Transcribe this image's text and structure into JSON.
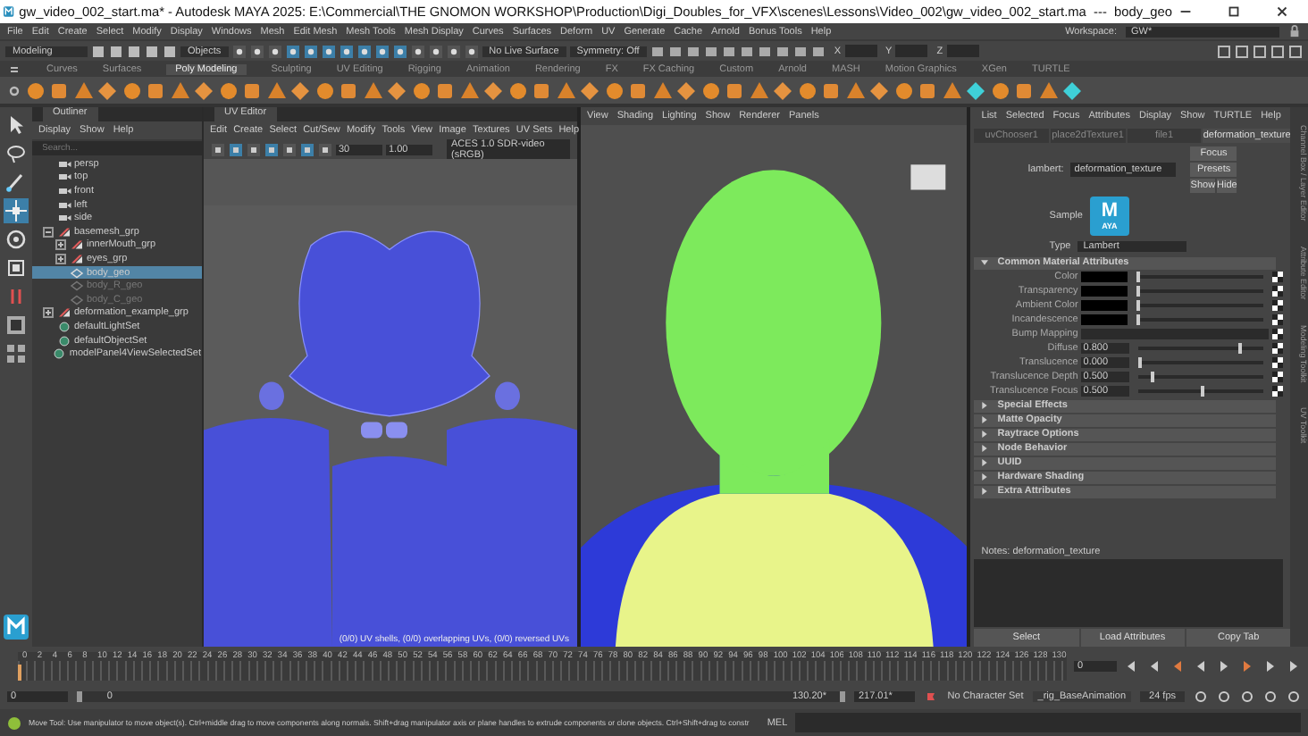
{
  "window": {
    "title": "gw_video_002_start.ma* - Autodesk MAYA 2025: E:\\Commercial\\THE GNOMON WORKSHOP\\Production\\Digi_Doubles_for_VFX\\scenes\\Lessons\\Video_002\\gw_video_002_start.ma  ---  body_geo"
  },
  "menu_bar": [
    "File",
    "Edit",
    "Create",
    "Select",
    "Modify",
    "Display",
    "Windows",
    "Mesh",
    "Edit Mesh",
    "Mesh Tools",
    "Mesh Display",
    "Curves",
    "Surfaces",
    "Deform",
    "UV",
    "Generate",
    "Cache",
    "Arnold",
    "Bonus Tools",
    "Help"
  ],
  "workspace": {
    "label": "Workspace:",
    "value": "GW*"
  },
  "status_line": {
    "menu_set": "Modeling",
    "selection_mode": "Objects",
    "live_surface": "No Live Surface",
    "symmetry": "Symmetry: Off",
    "axes": [
      "X",
      "Y",
      "Z"
    ]
  },
  "shelf_tabs": [
    {
      "label": "Curves",
      "selected": false
    },
    {
      "label": "Surfaces",
      "selected": false
    },
    {
      "label": "Poly Modeling",
      "selected": true
    },
    {
      "label": "Sculpting",
      "selected": false
    },
    {
      "label": "UV Editing",
      "selected": false
    },
    {
      "label": "Rigging",
      "selected": false
    },
    {
      "label": "Animation",
      "selected": false
    },
    {
      "label": "Rendering",
      "selected": false
    },
    {
      "label": "FX",
      "selected": false
    },
    {
      "label": "FX Caching",
      "selected": false
    },
    {
      "label": "Custom",
      "selected": false
    },
    {
      "label": "Arnold",
      "selected": false
    },
    {
      "label": "MASH",
      "selected": false
    },
    {
      "label": "Motion Graphics",
      "selected": false
    },
    {
      "label": "XGen",
      "selected": false
    },
    {
      "label": "TURTLE",
      "selected": false
    }
  ],
  "toolbox": [
    {
      "kind": "select",
      "selected": false
    },
    {
      "kind": "lasso",
      "selected": false
    },
    {
      "kind": "paint",
      "selected": false
    },
    {
      "kind": "move",
      "selected": true
    },
    {
      "kind": "rotate",
      "selected": false
    },
    {
      "kind": "scale",
      "selected": false
    }
  ],
  "outliner": {
    "title": "Outliner",
    "menu": [
      "Display",
      "Show",
      "Help"
    ],
    "search": {
      "placeholder": "Search..."
    },
    "items": [
      {
        "name": "persp",
        "kind": "camera",
        "selected": false,
        "hidden": false
      },
      {
        "name": "top",
        "kind": "camera",
        "selected": false,
        "hidden": false
      },
      {
        "name": "front",
        "kind": "camera",
        "selected": false,
        "hidden": false
      },
      {
        "name": "left",
        "kind": "camera",
        "selected": false,
        "hidden": false
      },
      {
        "name": "side",
        "kind": "camera",
        "selected": false,
        "hidden": false
      },
      {
        "name": "basemesh_grp",
        "kind": "group",
        "selected": false,
        "hidden": false,
        "expanded": true,
        "children": [
          {
            "name": "innerMouth_grp",
            "kind": "group",
            "selected": false,
            "hidden": false,
            "expanded": false
          },
          {
            "name": "eyes_grp",
            "kind": "group",
            "selected": false,
            "hidden": false,
            "expanded": false
          },
          {
            "name": "body_geo",
            "kind": "mesh",
            "selected": true,
            "hidden": false
          },
          {
            "name": "body_R_geo",
            "kind": "mesh",
            "selected": false,
            "hidden": true
          },
          {
            "name": "body_C_geo",
            "kind": "mesh",
            "selected": false,
            "hidden": true
          }
        ]
      },
      {
        "name": "deformation_example_grp",
        "kind": "group",
        "selected": false,
        "hidden": false,
        "expanded": false
      },
      {
        "name": "defaultLightSet",
        "kind": "set",
        "selected": false,
        "hidden": false
      },
      {
        "name": "defaultObjectSet",
        "kind": "set",
        "selected": false,
        "hidden": false
      },
      {
        "name": "modelPanel4ViewSelectedSet",
        "kind": "set",
        "selected": false,
        "hidden": false
      }
    ]
  },
  "uv_editor": {
    "title": "UV Editor",
    "menu": [
      "Edit",
      "Create",
      "Select",
      "Cut/Sew",
      "Modify",
      "Tools",
      "View",
      "Image",
      "Textures",
      "UV Sets",
      "Help"
    ],
    "field_1": "30",
    "field_2": "1.00",
    "color_space": "ACES 1.0 SDR-video (sRGB)",
    "info": "(0/0) UV shells, (0/0) overlapping UVs, (0/0) reversed UVs"
  },
  "viewport": {
    "menu": [
      "View",
      "Shading",
      "Lighting",
      "Show",
      "Renderer",
      "Panels"
    ]
  },
  "attribute_editor": {
    "menu": [
      "List",
      "Selected",
      "Focus",
      "Attributes",
      "Display",
      "Show",
      "TURTLE",
      "Help"
    ],
    "tabs": [
      {
        "label": "uvChooser1",
        "selected": false
      },
      {
        "label": "place2dTexture1",
        "selected": false
      },
      {
        "label": "file1",
        "selected": false
      },
      {
        "label": "deformation_texture",
        "selected": true
      }
    ],
    "node_label": "lambert:",
    "node_name": "deformation_texture",
    "buttons": [
      "Focus",
      "Presets",
      "Show",
      "Hide"
    ],
    "sample_label": "Sample",
    "logo_letter": "M",
    "logo_word": "AYA",
    "type_label": "Type",
    "type_value": "Lambert",
    "sections": [
      {
        "title": "Common Material Attributes",
        "expanded": true,
        "rows": [
          {
            "kind": "color",
            "label": "Color",
            "level": 0
          },
          {
            "kind": "color",
            "label": "Transparency",
            "level": 0
          },
          {
            "kind": "color",
            "label": "Ambient Color",
            "level": 0
          },
          {
            "kind": "color",
            "label": "Incandescence",
            "level": 0
          },
          {
            "kind": "map",
            "label": "Bump Mapping"
          },
          {
            "kind": "number",
            "label": "Diffuse",
            "value": "0.800",
            "level": 0.8
          },
          {
            "kind": "number",
            "label": "Translucence",
            "value": "0.000",
            "level": 0
          },
          {
            "kind": "number",
            "label": "Translucence Depth",
            "value": "0.500",
            "level": 0.1
          },
          {
            "kind": "number",
            "label": "Translucence Focus",
            "value": "0.500",
            "level": 0.5
          }
        ]
      },
      {
        "title": "Special Effects",
        "expanded": false
      },
      {
        "title": "Matte Opacity",
        "expanded": false
      },
      {
        "title": "Raytrace Options",
        "expanded": false
      },
      {
        "title": "Node Behavior",
        "expanded": false
      },
      {
        "title": "UUID",
        "expanded": false
      },
      {
        "title": "Hardware Shading",
        "expanded": false
      },
      {
        "title": "Extra Attributes",
        "expanded": false
      }
    ],
    "notes_label": "Notes:  deformation_texture",
    "footer_buttons": [
      "Select",
      "Load Attributes",
      "Copy Tab"
    ]
  },
  "side_tabs": [
    "Channel Box / Layer Editor",
    "Attribute Editor",
    "Modeling Toolkit",
    "UV Toolkit"
  ],
  "time_slider": {
    "frames": [
      "0",
      "2",
      "4",
      "6",
      "8",
      "10",
      "12",
      "14",
      "16",
      "18",
      "20",
      "22",
      "24",
      "26",
      "28",
      "30",
      "32",
      "34",
      "36",
      "38",
      "40",
      "42",
      "44",
      "46",
      "48",
      "50",
      "52",
      "54",
      "56",
      "58",
      "60",
      "62",
      "64",
      "66",
      "68",
      "70",
      "72",
      "74",
      "76",
      "78",
      "80",
      "82",
      "84",
      "86",
      "88",
      "90",
      "92",
      "94",
      "96",
      "98",
      "100",
      "102",
      "104",
      "106",
      "108",
      "110",
      "112",
      "114",
      "116",
      "118",
      "120",
      "122",
      "124",
      "126",
      "128",
      "130"
    ],
    "current_frame": "0",
    "level": 0
  },
  "range_slider": {
    "start": "0",
    "range_start": "0",
    "range_end": "130.20*",
    "level": 1,
    "end": "217.01*",
    "character_set": "No Character Set",
    "anim_layer": "_rig_BaseAnimation",
    "fps": "24 fps"
  },
  "help_line": {
    "text": "Move Tool: Use manipulator to move object(s). Ctrl+middle drag to move components along normals. Shift+drag manipulator axis or plane handles to extrude components or clone objects. Ctrl+Shift+drag to constr",
    "command_label": "MEL"
  }
}
